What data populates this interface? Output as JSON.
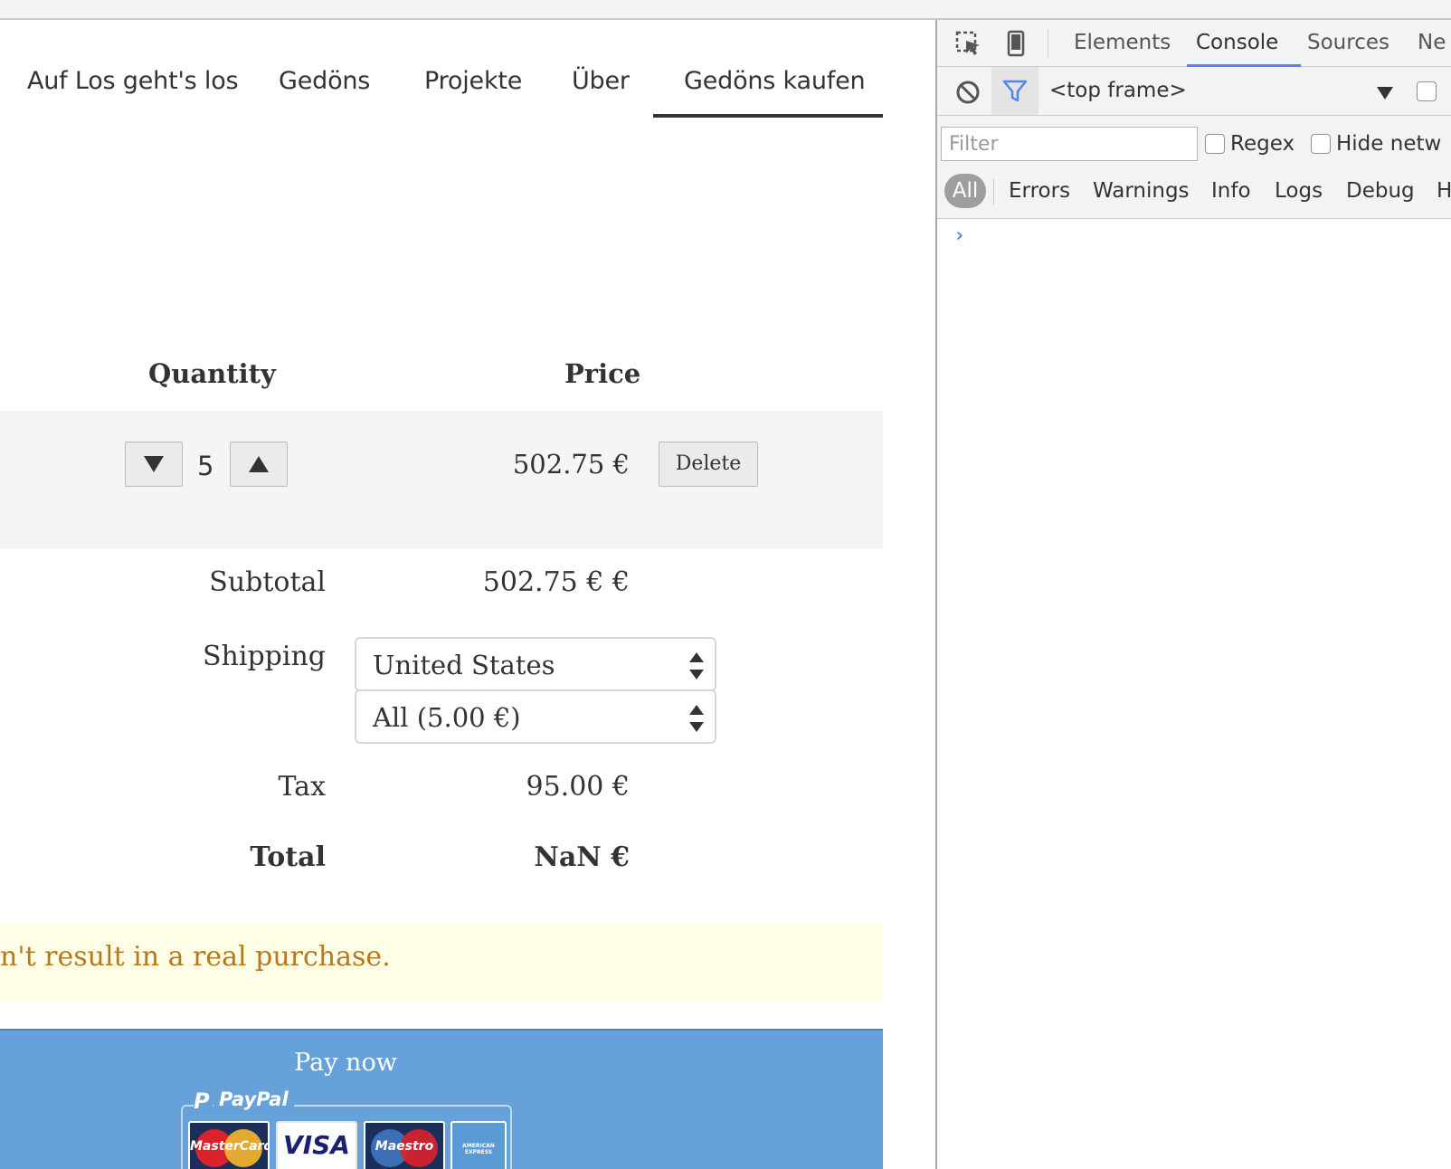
{
  "nav": {
    "items": [
      "Auf Los geht's los",
      "Gedöns",
      "Projekte",
      "Über",
      "Gedöns kaufen"
    ],
    "active_index": 4
  },
  "cart": {
    "headers": {
      "quantity": "Quantity",
      "price": "Price"
    },
    "row": {
      "quantity": "5",
      "price": "502.75 €",
      "delete_label": "Delete"
    }
  },
  "summary": {
    "subtotal_label": "Subtotal",
    "subtotal_value": "502.75 € €",
    "shipping_label": "Shipping",
    "shipping_country": "United States",
    "shipping_method": "All (5.00 €)",
    "tax_label": "Tax",
    "tax_value": "95.00 €",
    "total_label": "Total",
    "total_value": "NaN €"
  },
  "notice": {
    "text": "n't result in a real purchase."
  },
  "payment": {
    "pay_label": "Pay now",
    "paypal_label": "PayPal",
    "cards": [
      "MasterCard",
      "VISA",
      "Maestro",
      "AMERICAN EXPRESS"
    ]
  },
  "devtools": {
    "tabs": [
      "Elements",
      "Console",
      "Sources",
      "Ne"
    ],
    "active_tab": "Console",
    "context": "<top frame>",
    "filter_placeholder": "Filter",
    "regex_label": "Regex",
    "hide_network_label": "Hide netw",
    "levels": [
      "All",
      "Errors",
      "Warnings",
      "Info",
      "Logs",
      "Debug",
      "H"
    ],
    "prompt": "›",
    "accent_color": "#4d88f0"
  },
  "colors": {
    "pay_panel": "#66a2d9",
    "notice_bg": "#fefde6",
    "notice_text": "#b8771a"
  }
}
